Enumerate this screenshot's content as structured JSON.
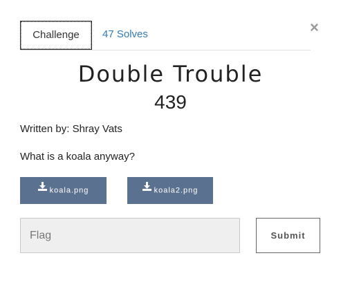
{
  "tabs": {
    "challenge_label": "Challenge",
    "solves_label": "47 Solves"
  },
  "close_label": "×",
  "challenge": {
    "name": "Double Trouble",
    "value": "439",
    "author": "Written by: Shray Vats",
    "description": "What is a koala anyway?"
  },
  "files": [
    {
      "label": "koala.png",
      "icon": "download-icon"
    },
    {
      "label": "koala2.png",
      "icon": "download-icon"
    }
  ],
  "flag_input": {
    "placeholder": "Flag",
    "value": ""
  },
  "submit_label": "Submit",
  "colors": {
    "accent_link": "#337ab7",
    "file_button_bg": "#5b7190"
  }
}
